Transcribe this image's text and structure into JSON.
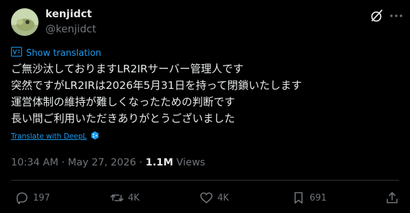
{
  "author": {
    "name": "kenjidct",
    "handle": "@kenjidct"
  },
  "translate": {
    "show_label": "Show translation",
    "deepl_label": "Translate with DeepL"
  },
  "tweet": {
    "lines": [
      "ご無沙汰しておりますLR2IRサーバー管理人です",
      "突然ですがLR2IRは2026年5月31日を持って閉鎖いたします",
      "運営体制の維持が難しくなったための判断です",
      "長い間ご利用いただきありがとうございました"
    ]
  },
  "meta": {
    "time": "10:34 AM",
    "separator": " · ",
    "date": "May 27, 2026",
    "views_count": "1.1M",
    "views_label": "Views"
  },
  "actions": {
    "replies": "197",
    "reposts": "4K",
    "likes": "4K",
    "bookmarks": "691"
  },
  "colors": {
    "background": "#000000",
    "text": "#e7e9ea",
    "muted": "#71767b",
    "link": "#1d9bf0"
  }
}
